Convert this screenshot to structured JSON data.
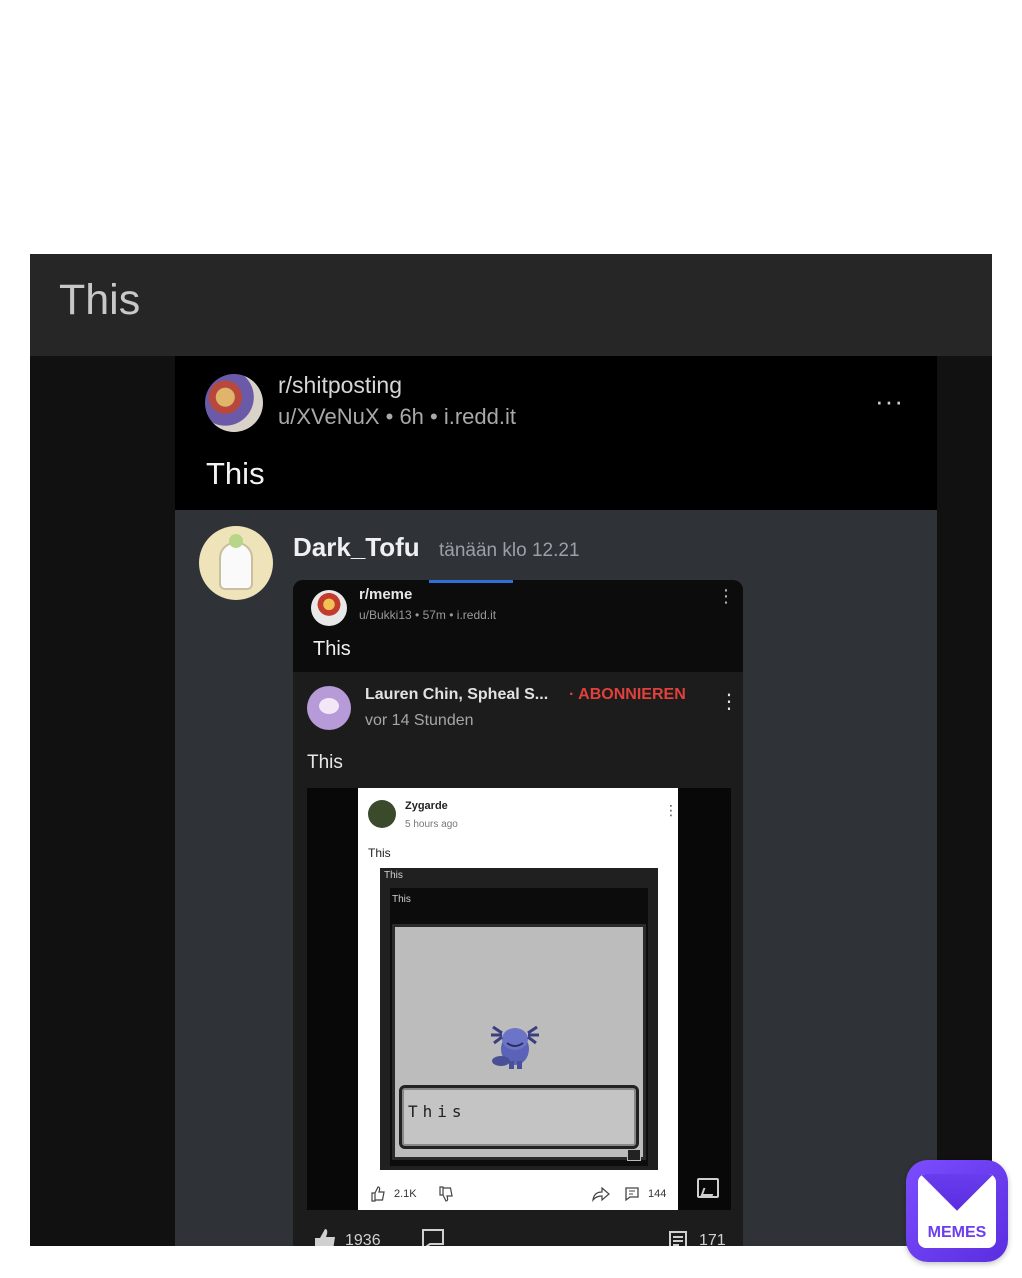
{
  "card": {
    "title": "This"
  },
  "reddit_post": {
    "subreddit": "r/shitposting",
    "meta": "u/XVeNuX • 6h • i.redd.it",
    "more": "···",
    "title": "This"
  },
  "discord_message": {
    "author": "Dark_Tofu",
    "timestamp": "tänään klo 12.21"
  },
  "inner_post": {
    "subreddit": "r/meme",
    "meta": "u/Bukki13 • 57m • i.redd.it",
    "title": "This",
    "dots": "⋮"
  },
  "youtube_post": {
    "channel": "Lauren Chin, Spheal S...",
    "subscribe": "· ABONNIEREN",
    "time": "vor 14 Stunden",
    "text": "This",
    "dots": "⋮"
  },
  "zygarde_post": {
    "author": "Zygarde",
    "time": "5 hours ago",
    "text": "This",
    "nested_title_1": "This",
    "nested_title_2": "This",
    "dialog_text": "This",
    "likes": "2.1K",
    "comments": "144",
    "dots": "⋮"
  },
  "bottom_bar": {
    "likes": "1936",
    "count": "171"
  },
  "badge": {
    "label": "MEMES"
  },
  "icons": [
    "three-dots-icon",
    "thumbs-up-icon",
    "thumbs-down-icon",
    "share-icon",
    "comment-icon",
    "image-icon",
    "envelope-icon"
  ]
}
